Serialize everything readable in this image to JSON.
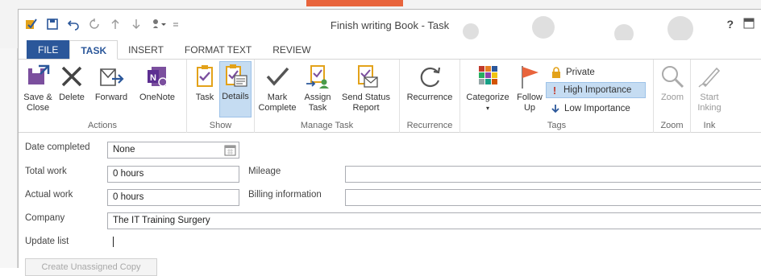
{
  "window": {
    "title": "Finish writing Book - Task",
    "help": "?"
  },
  "tabs": [
    "FILE",
    "TASK",
    "INSERT",
    "FORMAT TEXT",
    "REVIEW"
  ],
  "ribbon": {
    "actions": {
      "save_close": "Save &\nClose",
      "delete": "Delete",
      "forward": "Forward",
      "onenote": "OneNote",
      "label": "Actions"
    },
    "show": {
      "task": "Task",
      "details": "Details",
      "label": "Show"
    },
    "manage": {
      "mark_complete": "Mark\nComplete",
      "assign": "Assign\nTask",
      "send_status": "Send Status\nReport",
      "label": "Manage Task"
    },
    "recurrence": {
      "recurrence": "Recurrence",
      "label": "Recurrence"
    },
    "tags": {
      "categorize": "Categorize",
      "follow_up": "Follow\nUp",
      "private": "Private",
      "high": "High Importance",
      "low": "Low Importance",
      "label": "Tags"
    },
    "zoom": {
      "zoom": "Zoom",
      "label": "Zoom"
    },
    "ink": {
      "start_inking": "Start\nInking",
      "label": "Ink"
    }
  },
  "form": {
    "date_completed_label": "Date completed",
    "date_completed_value": "None",
    "total_work_label": "Total work",
    "total_work_value": "0 hours",
    "actual_work_label": "Actual work",
    "actual_work_value": "0 hours",
    "mileage_label": "Mileage",
    "mileage_value": "",
    "billing_label": "Billing information",
    "billing_value": "",
    "company_label": "Company",
    "company_value": "The IT Training Surgery",
    "update_list_label": "Update list",
    "create_unassigned": "Create Unassigned Copy"
  },
  "colors": {
    "file_tab": "#2b579a",
    "selected": "#c5dcf2",
    "flag": "#e8643c",
    "importance": "#c0392b",
    "lock": "#e3a21a"
  }
}
